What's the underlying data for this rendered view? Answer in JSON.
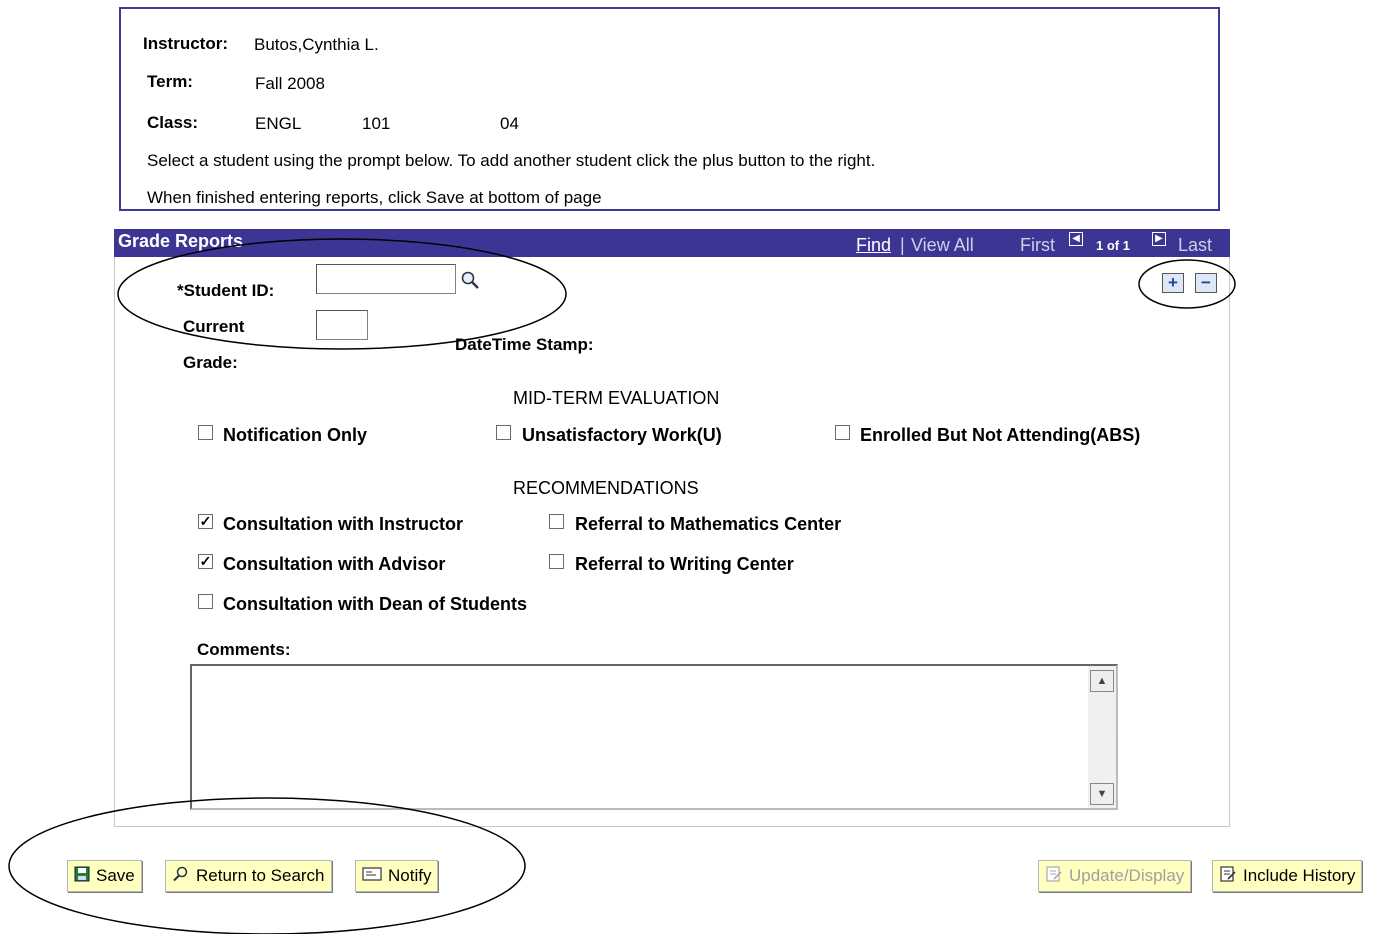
{
  "header": {
    "instructor_label": "Instructor:",
    "instructor_value": "Butos,Cynthia L.",
    "term_label": "Term:",
    "term_value": "Fall 2008",
    "class_label": "Class:",
    "class_subject": "ENGL",
    "class_number": "101",
    "class_section": "04",
    "instruction_1": "Select a student using the prompt below. To add another student click the plus button to the right.",
    "instruction_2": "When finished entering reports, click Save at bottom of page"
  },
  "grid": {
    "title": "Grade Reports",
    "find": "Find",
    "separator": "|",
    "view_all": "View All",
    "first": "First",
    "page_info": "1 of 1",
    "last": "Last",
    "add_row": "+",
    "delete_row": "−"
  },
  "form": {
    "student_id_label": "*Student ID:",
    "student_id_value": "",
    "current_label": "Current",
    "grade_label": "Grade:",
    "current_grade_value": "",
    "datetime_label": "DateTime Stamp:",
    "midterm_header": "MID-TERM EVALUATION",
    "midterm": [
      {
        "label": "Notification Only",
        "checked": false
      },
      {
        "label": "Unsatisfactory Work(U)",
        "checked": false
      },
      {
        "label": "Enrolled But Not Attending(ABS)",
        "checked": false
      }
    ],
    "recommendations_header": "RECOMMENDATIONS",
    "recommendations": [
      {
        "label": "Consultation with Instructor",
        "checked": true
      },
      {
        "label": "Referral to Mathematics Center",
        "checked": false
      },
      {
        "label": "Consultation with Advisor",
        "checked": true
      },
      {
        "label": "Referral to Writing Center",
        "checked": false
      },
      {
        "label": "Consultation with Dean of Students",
        "checked": false
      }
    ],
    "comments_label": "Comments:",
    "comments_value": ""
  },
  "buttons": {
    "save": "Save",
    "return_to_search": "Return to Search",
    "notify": "Notify",
    "update_display": "Update/Display",
    "include_history": "Include History"
  },
  "icons": {
    "lookup": "magnifier-icon",
    "save": "floppy-icon",
    "return": "search-return-icon",
    "notify": "notify-icon",
    "update": "update-icon",
    "history": "history-icon"
  },
  "colors": {
    "grid_header": "#3d3594",
    "info_border": "#3a3a9a",
    "button_bg": "#ffffc0"
  }
}
